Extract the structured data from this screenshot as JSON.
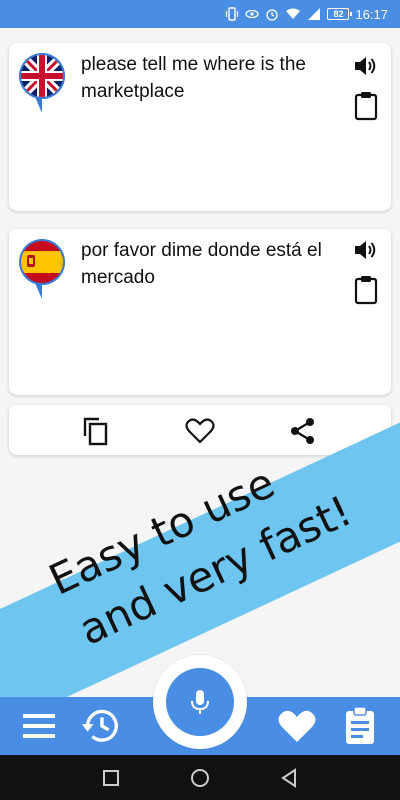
{
  "status_bar": {
    "battery": "82",
    "time": "16:17"
  },
  "source": {
    "text": "please tell me where is the marketplace",
    "flag": "united-kingdom-flag"
  },
  "target": {
    "text": "por favor dime donde está el mercado",
    "flag": "spain-flag"
  },
  "promo": {
    "line1": "Easy to use",
    "line2": "and very fast!"
  },
  "colors": {
    "primary": "#4a8de5",
    "banner": "#6ec6f0",
    "card": "#ffffff"
  },
  "icons": {
    "speaker": "volume-icon",
    "clipboard": "clipboard-icon",
    "copy": "copy-icon",
    "favorite": "heart-icon",
    "share": "share-icon",
    "mic": "microphone-icon",
    "menu": "menu-icon",
    "history": "history-icon",
    "notes": "notes-icon"
  }
}
